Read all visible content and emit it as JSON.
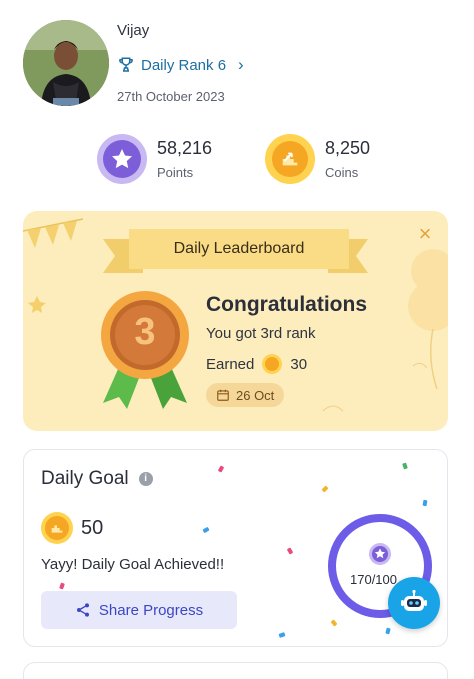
{
  "profile": {
    "name": "Vijay",
    "rank_label": "Daily Rank 6",
    "date": "27th October 2023"
  },
  "stats": {
    "points": {
      "value": "58,216",
      "label": "Points",
      "icon": "star-badge-icon"
    },
    "coins": {
      "value": "8,250",
      "label": "Coins",
      "icon": "coin-badge-icon"
    }
  },
  "leaderboard": {
    "title": "Daily Leaderboard",
    "medal_number": "3",
    "heading": "Congratulations",
    "rank_text": "You got 3rd rank",
    "earned_label": "Earned",
    "earned_value": "30",
    "date_chip": "26 Oct"
  },
  "daily_goal": {
    "title": "Daily Goal",
    "coins": "50",
    "message": "Yayy! Daily Goal Achieved!!",
    "share_label": "Share Progress",
    "progress_text": "170/100",
    "progress_fraction": 1.0
  },
  "colors": {
    "accent_link": "#1c6fa3",
    "points_purple": "#7d5ed9",
    "coin_orange": "#f5a623",
    "leaderboard_bg": "#fdedbd",
    "share_button_bg": "#e7e9fb",
    "share_button_text": "#3c46c4",
    "progress_ring": "#6c5ce7",
    "bot_button": "#1aa4e8"
  }
}
